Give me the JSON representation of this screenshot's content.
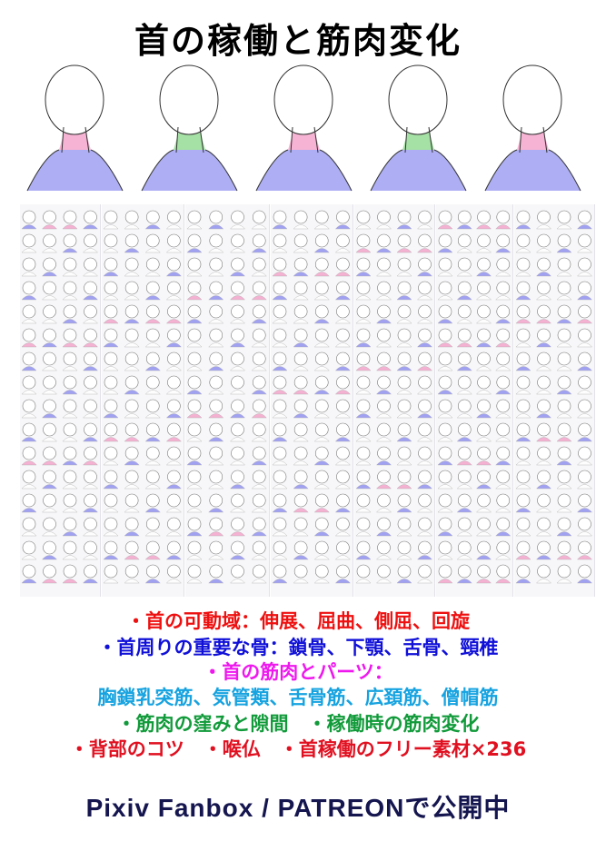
{
  "title": "首の稼働と筋肉変化",
  "features": {
    "range_of_motion": "・首の可動域：伸展、屈曲、側屈、回旋",
    "bones": "・首周りの重要な骨：鎖骨、下顎、舌骨、頸椎",
    "muscles_heading": "・首の筋肉とパーツ：",
    "muscles_list": "胸鎖乳突筋、気管類、舌骨筋、広頚筋、僧帽筋",
    "hollows": "・筋肉の窪みと隙間　・稼働時の筋肉変化",
    "extras": "・背部のコツ　・喉仏　・首稼働のフリー素材×236"
  },
  "footer": "Pixiv Fanbox / PATREONで公開中",
  "colors": {
    "title": "#000000",
    "range_of_motion": "#ee1010",
    "bones": "#1010d8",
    "muscles_heading": "#ee18ee",
    "muscles_list": "#17a3e0",
    "hollows": "#119a3a",
    "extras": "#e01020",
    "footer": "#15154f",
    "muscle_blue": "#8c8cf0",
    "muscle_green": "#8fd88f",
    "muscle_pink": "#f4a0c8"
  }
}
